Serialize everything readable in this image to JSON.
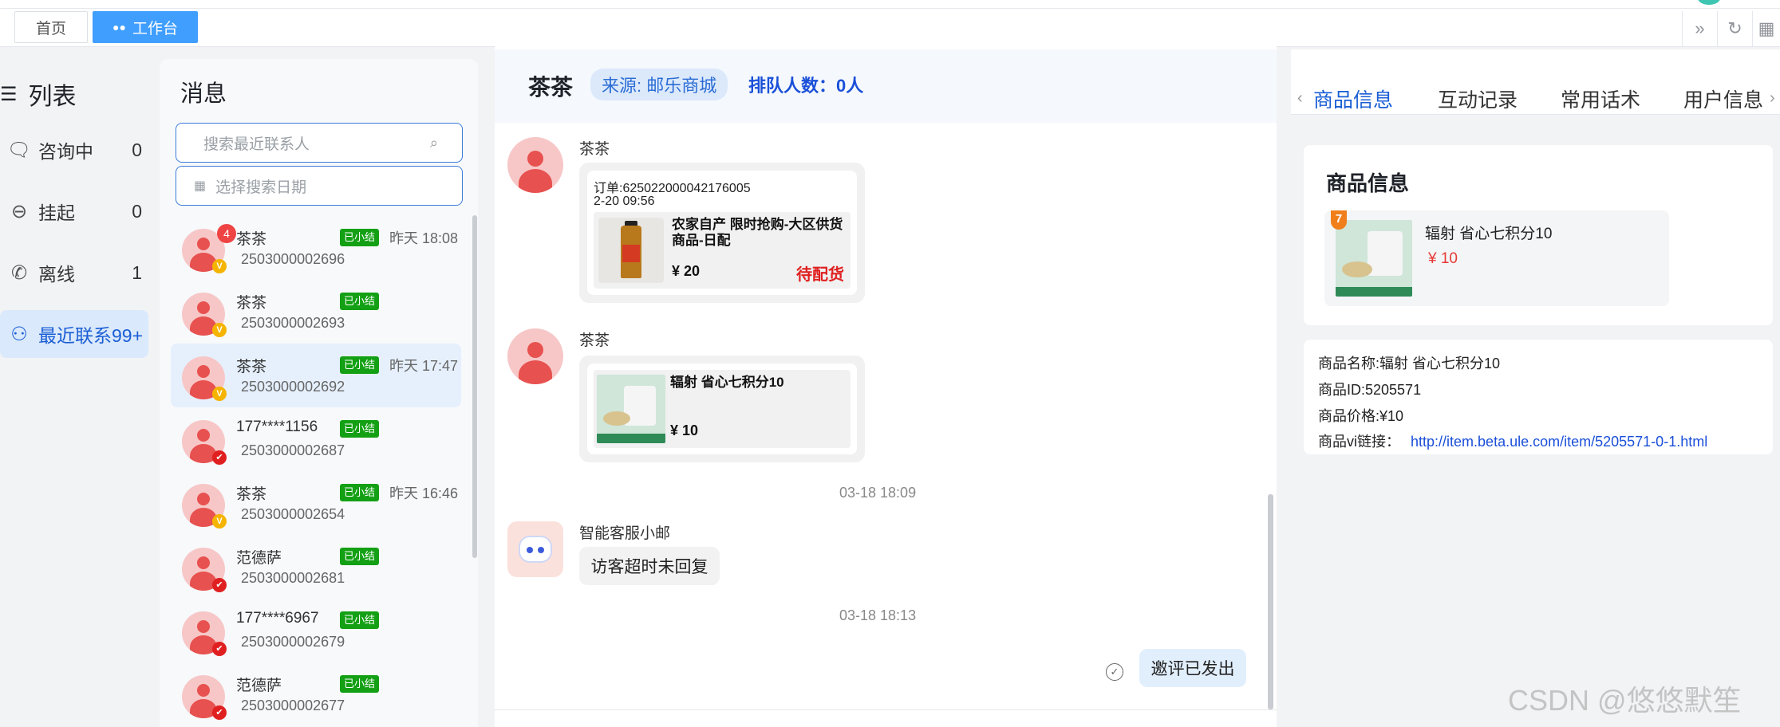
{
  "topbar": {
    "tabs": [
      {
        "label": "首页"
      },
      {
        "label": "工作台"
      }
    ]
  },
  "leftnav": {
    "title": "列表",
    "items": [
      {
        "label": "咨询中",
        "count": "0"
      },
      {
        "label": "挂起",
        "count": "0"
      },
      {
        "label": "离线",
        "count": "1"
      },
      {
        "label": "最近联系99+",
        "count": ""
      }
    ]
  },
  "messages": {
    "title": "消息",
    "search_placeholder": "搜索最近联系人",
    "date_placeholder": "选择搜索日期",
    "contacts": [
      {
        "name": "茶茶",
        "id": "2503000002696",
        "tag": "已小结",
        "time": "昨天 18:08",
        "unread": "4",
        "badge": "V"
      },
      {
        "name": "茶茶",
        "id": "2503000002693",
        "tag": "已小结",
        "time": "",
        "unread": "",
        "badge": "V"
      },
      {
        "name": "茶茶",
        "id": "2503000002692",
        "tag": "已小结",
        "time": "昨天 17:47",
        "unread": "",
        "badge": "V"
      },
      {
        "name": "177****1156",
        "id": "2503000002687",
        "tag": "已小结",
        "time": "",
        "unread": "",
        "badge": "✔"
      },
      {
        "name": "茶茶",
        "id": "2503000002654",
        "tag": "已小结",
        "time": "昨天 16:46",
        "unread": "",
        "badge": "V"
      },
      {
        "name": "范德萨",
        "id": "2503000002681",
        "tag": "已小结",
        "time": "",
        "unread": "",
        "badge": "✔"
      },
      {
        "name": "177****6967",
        "id": "2503000002679",
        "tag": "已小结",
        "time": "",
        "unread": "",
        "badge": "✔"
      },
      {
        "name": "范德萨",
        "id": "2503000002677",
        "tag": "已小结",
        "time": "",
        "unread": "",
        "badge": "✔"
      }
    ]
  },
  "chat": {
    "name": "茶茶",
    "source": "来源: 邮乐商城",
    "queue": "排队人数：0人",
    "msg1": {
      "sender": "茶茶",
      "order_no": "订单:625022000042176005",
      "order_time": "2-20 09:56",
      "product_title": "农家自产 限时抢购-大区供货商品-日配",
      "price": "¥ 20",
      "status": "待配货"
    },
    "msg2": {
      "sender": "茶茶",
      "product_title": "辐射 省心七积分10",
      "price": "¥ 10"
    },
    "time1": "03-18 18:09",
    "bot_name": "智能客服小邮",
    "bot_msg": "访客超时未回复",
    "time2": "03-18 18:13",
    "self_msg": "邀评已发出"
  },
  "right": {
    "tabs": [
      "商品信息",
      "互动记录",
      "常用话术",
      "用户信息"
    ],
    "card_title": "商品信息",
    "product_name": "辐射 省心七积分10",
    "product_price": "¥ 10",
    "detail_name": "商品名称:辐射 省心七积分10",
    "detail_id": "商品ID:5205571",
    "detail_price": "商品价格:¥10",
    "detail_link_label": "商品vi链接：",
    "detail_link": "http://item.beta.ule.com/item/5205571-0-1.html",
    "thumb_badge": "7"
  },
  "watermark": "CSDN @悠悠默笙",
  "colors": {
    "accent": "#409eff",
    "tag_green": "#14a014",
    "status_red": "#e02020",
    "price_red": "#e53935"
  }
}
